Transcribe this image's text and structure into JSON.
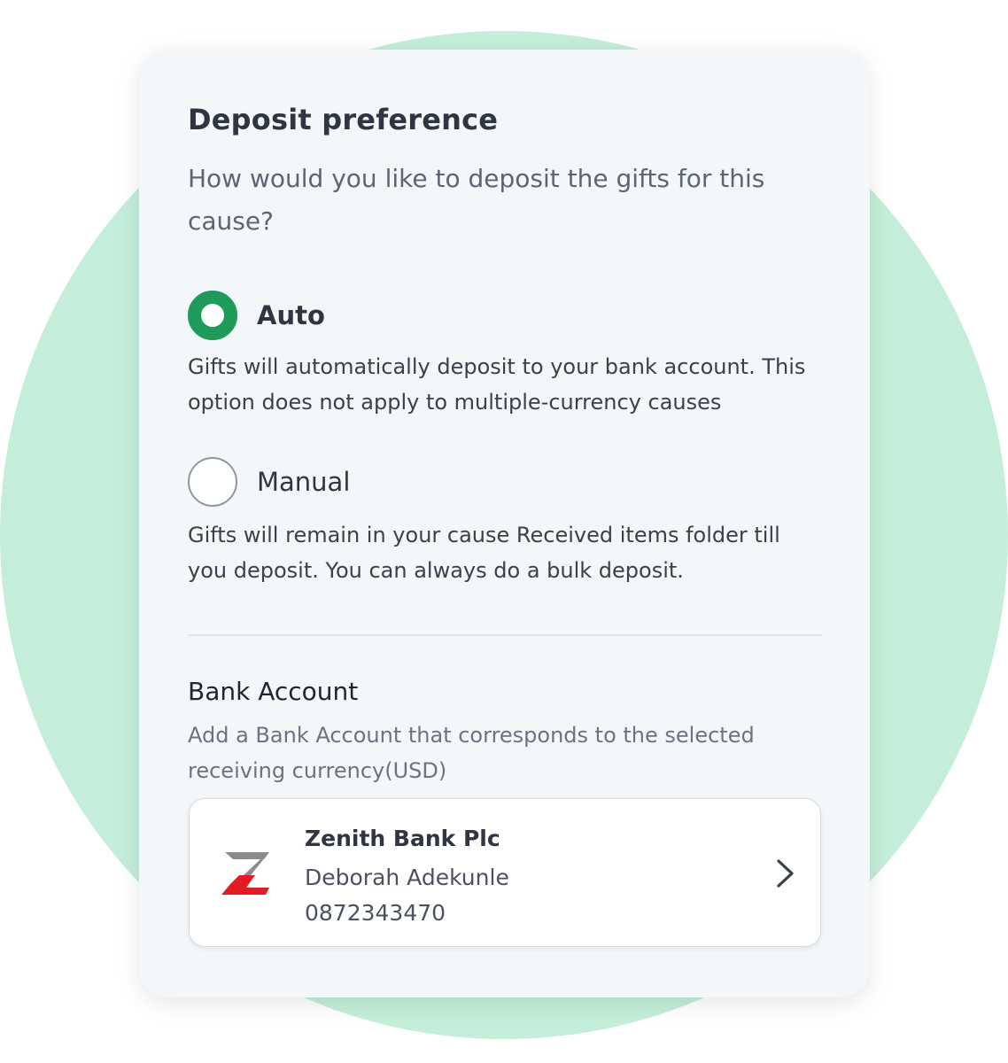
{
  "colors": {
    "accent": "#1e9a5a",
    "background_circle": "#c4eed9"
  },
  "deposit": {
    "title": "Deposit preference",
    "subtitle": "How would you like to deposit the gifts for this cause?",
    "options": [
      {
        "label": "Auto",
        "selected": true,
        "description": "Gifts will automatically deposit to your bank account. This option does not apply to multiple-currency causes"
      },
      {
        "label": "Manual",
        "selected": false,
        "description": "Gifts will remain in your cause Received items folder till you deposit. You can always do a bulk deposit."
      }
    ]
  },
  "bank_account": {
    "title": "Bank Account",
    "description": "Add a Bank Account that corresponds to the selected receiving currency(USD)",
    "card": {
      "logo_icon": "zenith-bank-logo-icon",
      "bank_name": "Zenith Bank Plc",
      "holder_name": "Deborah Adekunle",
      "account_number": "0872343470",
      "action_icon": "chevron-right-icon"
    }
  }
}
